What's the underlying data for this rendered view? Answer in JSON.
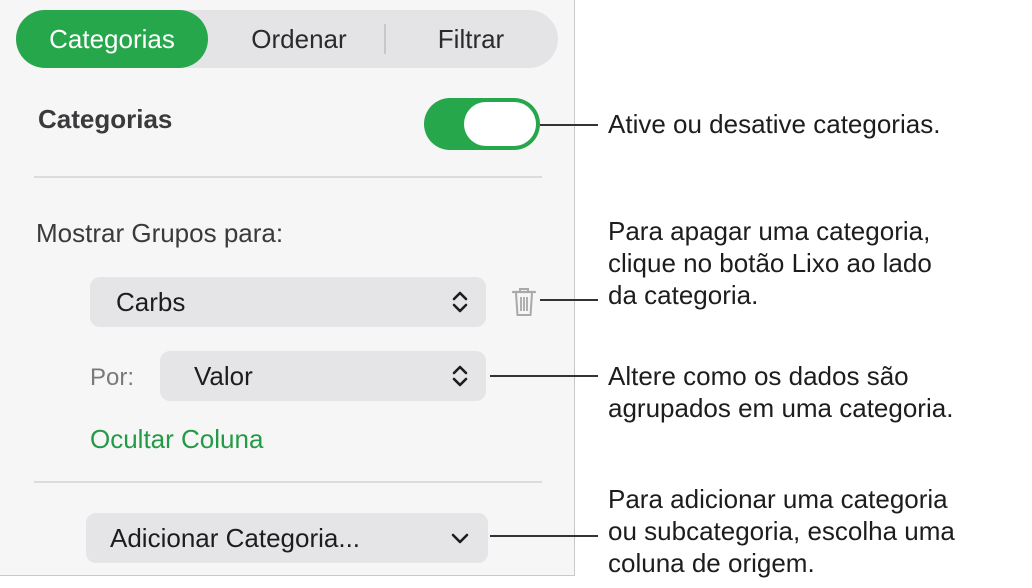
{
  "tabs": [
    {
      "label": "Categorias",
      "active": true
    },
    {
      "label": "Ordenar",
      "active": false
    },
    {
      "label": "Filtrar",
      "active": false
    }
  ],
  "categories_toggle": {
    "label": "Categorias",
    "on": true
  },
  "show_groups": {
    "label": "Mostrar Grupos para:",
    "column_value": "Carbs",
    "by_label": "Por:",
    "by_value": "Valor",
    "hide_column_link": "Ocultar Coluna"
  },
  "add_category": {
    "label": "Adicionar Categoria..."
  },
  "callouts": {
    "toggle": [
      "Ative ou desative categorias."
    ],
    "trash": [
      "Para apagar uma categoria,",
      "clique no botão Lixo ao lado",
      "da categoria."
    ],
    "group_by": [
      "Altere como os dados são",
      "agrupados em uma categoria."
    ],
    "add": [
      "Para adicionar uma categoria",
      "ou subcategoria, escolha uma",
      "coluna de origem."
    ]
  },
  "colors": {
    "accent": "#27a74c",
    "link": "#239a45"
  }
}
